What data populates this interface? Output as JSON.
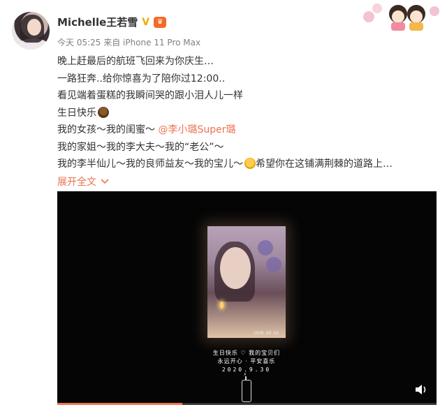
{
  "post": {
    "username": "Michelle王若雪",
    "verified_mark": "V",
    "meta": "今天 05:25 来自 iPhone 11 Pro Max",
    "lines": [
      "晚上赶最后的航班飞回来为你庆生…",
      "一路狂奔..给你惊喜为了陪你过12:00..",
      "看见端着蛋糕的我瞬间哭的跟小泪人儿一样",
      "生日快乐",
      "我的女孩～我的闺蜜～",
      "我的家姐～我的李大夫～我的“老公”～",
      "我的李半仙儿～我的良师益友～我的宝儿～",
      "希望你在这铺满荆棘的道路上…"
    ],
    "mention": "@李小璐Super璐",
    "expand_label": "展开全文"
  },
  "video": {
    "thumb_date": "2020.09.02",
    "caption_line1": "生日快乐 ♡ 我的宝贝们",
    "caption_line2": "永远开心 · 平安喜乐",
    "caption_date": "2020.9.30",
    "bolt": "⚡",
    "progress": 0.33
  },
  "colors": {
    "accent": "#eb7350",
    "verified": "#f2a900"
  },
  "icons": {
    "verified": "verified-v-icon",
    "vip": "vip-crown-icon",
    "cake": "cake-emoji-icon",
    "emoji": "smile-emoji-icon",
    "chevron": "chevron-down-icon",
    "volume": "volume-icon",
    "charger": "charger-icon"
  }
}
